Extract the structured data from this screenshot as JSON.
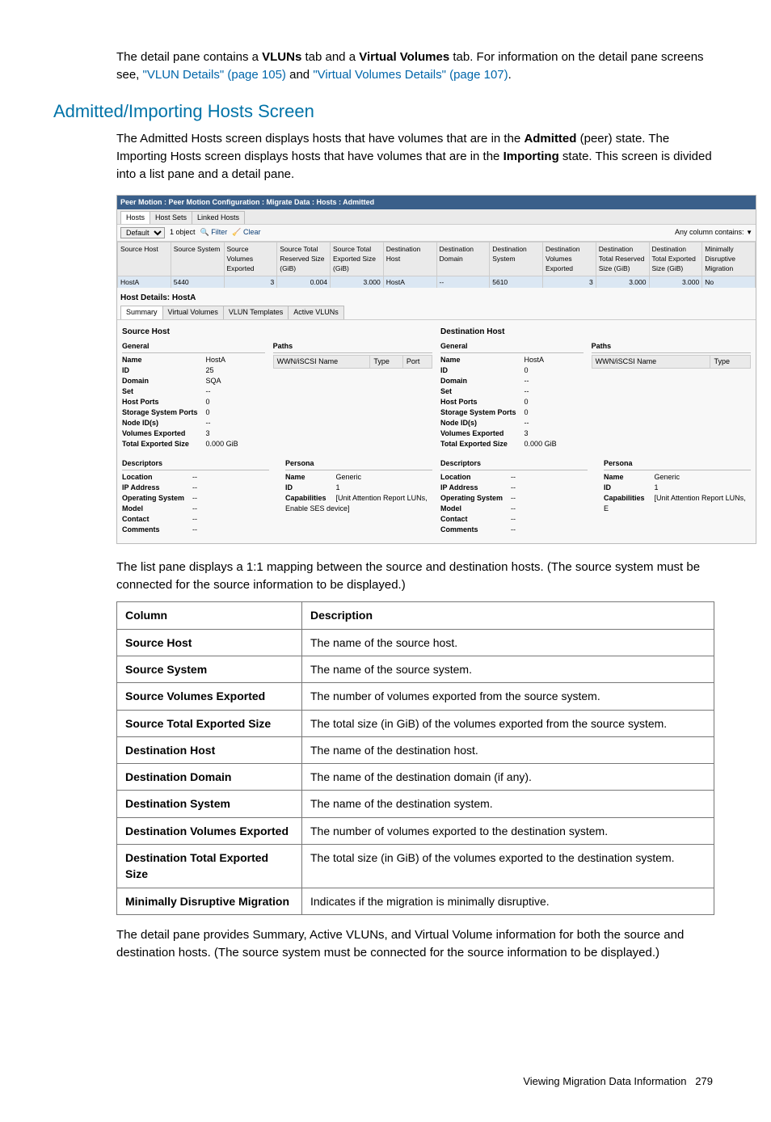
{
  "intro": {
    "p1_a": "The detail pane contains a ",
    "p1_b": " tab and a ",
    "p1_c": " tab. For information on the detail pane screens see, ",
    "p1_d": " and ",
    "p1_e": ".",
    "vluns": "VLUNs",
    "vvols": "Virtual Volumes",
    "link1": "\"VLUN Details\" (page 105)",
    "link2": "\"Virtual Volumes Details\" (page 107)"
  },
  "heading": "Admitted/Importing Hosts Screen",
  "para2_a": "The Admitted Hosts screen displays hosts that have volumes that are in the ",
  "para2_b": " (peer) state. The Importing Hosts screen displays hosts that have volumes that are in the ",
  "para2_c": " state. This screen is divided into a list pane and a detail pane.",
  "admitted": "Admitted",
  "importing": "Importing",
  "shot": {
    "title": "Peer Motion : Peer Motion Configuration : Migrate Data : Hosts : Admitted",
    "tabs": [
      "Hosts",
      "Host Sets",
      "Linked Hosts"
    ],
    "toolbar": {
      "default": "Default",
      "count": "1 object",
      "filter": "Filter",
      "clear": "Clear",
      "contains": "Any column contains:"
    },
    "cols": [
      "Source Host",
      "Source System",
      "Source Volumes Exported",
      "Source Total Reserved Size (GiB)",
      "Source Total Exported Size (GiB)",
      "Destination Host",
      "Destination Domain",
      "Destination System",
      "Destination Volumes Exported",
      "Destination Total Reserved Size (GiB)",
      "Destination Total Exported Size (GiB)",
      "Minimally Disruptive Migration"
    ],
    "row": [
      "HostA",
      "5440",
      "3",
      "0.004",
      "3.000",
      "HostA",
      "--",
      "5610",
      "3",
      "3.000",
      "3.000",
      "No"
    ],
    "detailTitle": "Host Details: HostA",
    "detailTabs": [
      "Summary",
      "Virtual Volumes",
      "VLUN Templates",
      "Active VLUNs"
    ],
    "src": {
      "title": "Source Host",
      "general": "General",
      "pathsTitle": "Paths",
      "pathCols": [
        "WWN/iSCSI Name",
        "Type",
        "Port"
      ],
      "kv": [
        [
          "Name",
          "HostA"
        ],
        [
          "ID",
          "25"
        ],
        [
          "Domain",
          "SQA"
        ],
        [
          "Set",
          "--"
        ],
        [
          "Host Ports",
          "0"
        ],
        [
          "Storage System Ports",
          "0"
        ],
        [
          "Node ID(s)",
          "--"
        ],
        [
          "Volumes Exported",
          "3"
        ],
        [
          "Total Exported Size",
          "0.000 GiB"
        ]
      ],
      "descTitle": "Descriptors",
      "desc": [
        [
          "Location",
          "--"
        ],
        [
          "IP Address",
          "--"
        ],
        [
          "Operating System",
          "--"
        ],
        [
          "Model",
          "--"
        ],
        [
          "Contact",
          "--"
        ],
        [
          "Comments",
          "--"
        ]
      ],
      "personaTitle": "Persona",
      "persona": [
        [
          "Name",
          "Generic"
        ],
        [
          "ID",
          "1"
        ],
        [
          "Capabilities",
          "[Unit Attention Report LUNs, Enable SES device]"
        ]
      ]
    },
    "dst": {
      "title": "Destination Host",
      "general": "General",
      "pathsTitle": "Paths",
      "pathCols": [
        "WWN/iSCSI Name",
        "Type"
      ],
      "kv": [
        [
          "Name",
          "HostA"
        ],
        [
          "ID",
          "0"
        ],
        [
          "Domain",
          "--"
        ],
        [
          "Set",
          "--"
        ],
        [
          "Host Ports",
          "0"
        ],
        [
          "Storage System Ports",
          "0"
        ],
        [
          "Node ID(s)",
          "--"
        ],
        [
          "Volumes Exported",
          "3"
        ],
        [
          "Total Exported Size",
          "0.000 GiB"
        ]
      ],
      "descTitle": "Descriptors",
      "desc": [
        [
          "Location",
          "--"
        ],
        [
          "IP Address",
          "--"
        ],
        [
          "Operating System",
          "--"
        ],
        [
          "Model",
          "--"
        ],
        [
          "Contact",
          "--"
        ],
        [
          "Comments",
          "--"
        ]
      ],
      "personaTitle": "Persona",
      "persona": [
        [
          "Name",
          "Generic"
        ],
        [
          "ID",
          "1"
        ],
        [
          "Capabilities",
          "[Unit Attention Report LUNs, E"
        ]
      ]
    }
  },
  "para3": "The list pane displays a 1:1 mapping between the source and destination hosts. (The source system must be connected for the source information to be displayed.)",
  "defs": {
    "head": [
      "Column",
      "Description"
    ],
    "rows": [
      [
        "Source Host",
        "The name of the source host."
      ],
      [
        "Source System",
        "The name of the source system."
      ],
      [
        "Source Volumes Exported",
        "The number of volumes exported from the source system."
      ],
      [
        "Source Total Exported Size",
        "The total size (in GiB) of the volumes exported from the source system."
      ],
      [
        "Destination Host",
        "The name of the destination host."
      ],
      [
        "Destination Domain",
        "The name of the destination domain (if any)."
      ],
      [
        "Destination System",
        "The name of the destination system."
      ],
      [
        "Destination Volumes Exported",
        "The number of volumes exported to the destination system."
      ],
      [
        "Destination Total Exported Size",
        "The total size (in GiB) of the volumes exported to the destination system."
      ],
      [
        "Minimally Disruptive Migration",
        "Indicates if the migration is minimally disruptive."
      ]
    ]
  },
  "para4": "The detail pane provides Summary, Active VLUNs, and Virtual Volume information for both the source and destination hosts. (The source system must be connected for the source information to be displayed.)",
  "footer_a": "Viewing Migration Data Information",
  "footer_b": "279"
}
